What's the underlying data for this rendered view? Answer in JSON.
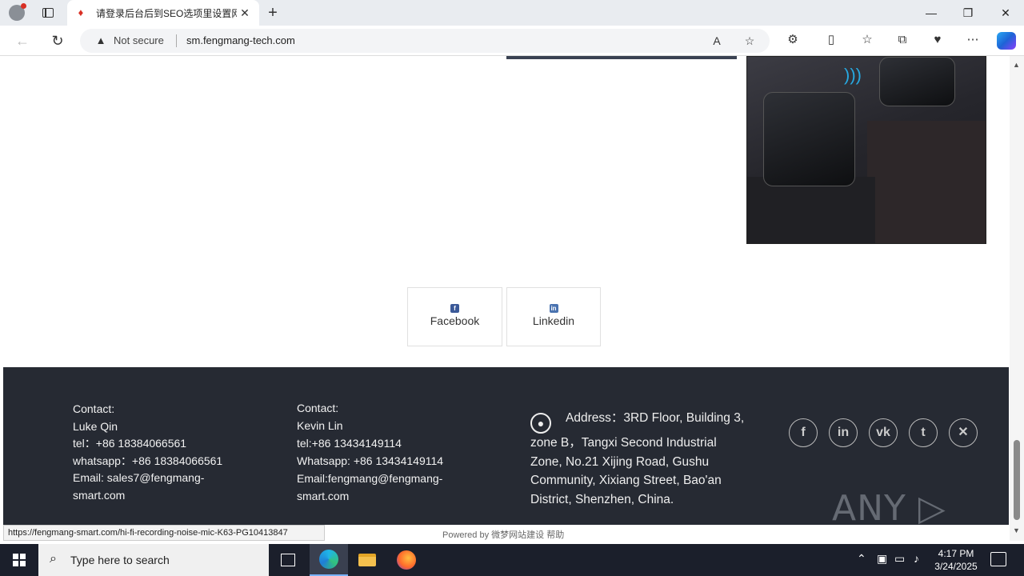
{
  "browser": {
    "tab_title": "请登录后台后到SEO选项里设置网",
    "not_secure": "Not secure",
    "url": "sm.fengmang-tech.com",
    "status_url": "https://fengmang-smart.com/hi-fi-recording-noise-mic-K63-PG10413847"
  },
  "share": {
    "facebook": "Facebook",
    "linkedin": "Linkedin"
  },
  "footer": {
    "contact1": {
      "label": "Contact:",
      "name": "Luke Qin",
      "tel": "tel：+86 18384066561",
      "whatsapp": "whatsapp：+86 18384066561",
      "email1": "Email: sales7@fengmang-",
      "email2": "smart.com"
    },
    "contact2": {
      "label": "Contact:",
      "name": "Kevin Lin",
      "tel": "tel:+86 13434149114",
      "whatsapp": "Whatsapp: +86 13434149114",
      "email1": "Email:fengmang@fengmang-",
      "email2": "smart.com"
    },
    "address": "Address：3RD Floor, Building 3, zone B，Tangxi Second Industrial Zone, No.21 Xijing Road, Gushu Community, Xixiang Street, Bao'an District, Shenzhen, China.",
    "social": [
      "facebook-icon",
      "linkedin-icon",
      "vk-icon",
      "tumblr-icon",
      "x-icon"
    ],
    "watermark": "ANY ▷ RUN"
  },
  "powered": {
    "prefix": "Powered by",
    "link1": "微梦网站建设",
    "link2": "帮助"
  },
  "taskbar": {
    "search_placeholder": "Type here to search",
    "time": "4:17 PM",
    "date": "3/24/2025"
  }
}
